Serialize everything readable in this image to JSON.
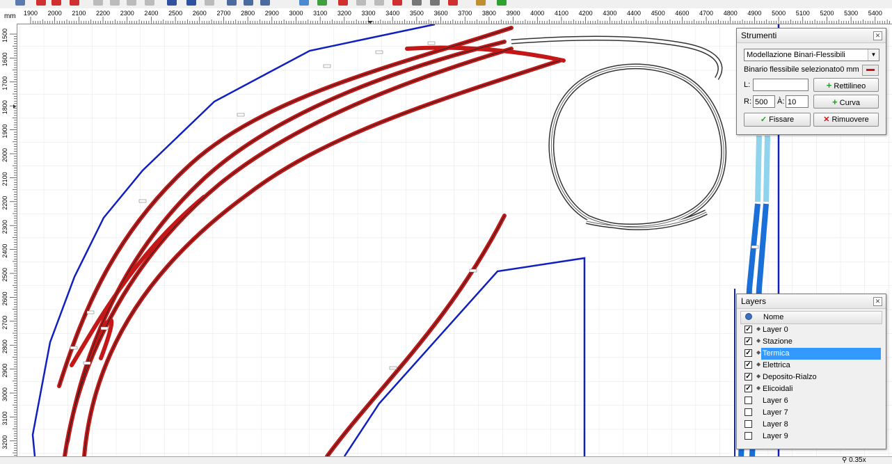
{
  "ruler": {
    "unit_label": "mm",
    "top_ticks": [
      "1900",
      "2000",
      "2100",
      "2200",
      "2300",
      "2400",
      "2500",
      "2600",
      "2700",
      "2800",
      "2900",
      "3000",
      "3100",
      "3200",
      "3300",
      "3400",
      "3500",
      "3600",
      "3700",
      "3800",
      "3900",
      "4000",
      "4100",
      "4200",
      "4300",
      "4400",
      "4500",
      "4600",
      "4700",
      "4800",
      "4900",
      "5000",
      "5100",
      "5200",
      "5300",
      "5400"
    ],
    "left_ticks": [
      "1500",
      "1600",
      "1700",
      "1800",
      "1900",
      "2000",
      "2100",
      "2200",
      "2300",
      "2400",
      "2500",
      "2600",
      "2700",
      "2800",
      "2900",
      "3000",
      "3100",
      "3200"
    ]
  },
  "strumenti": {
    "title": "Strumenti",
    "mode_value": "Modellazione Binari-Flessibili",
    "selected_info": "Binario flessibile selezionato0 mm",
    "length_label": "L:",
    "length_value": "",
    "radius_label": "R:",
    "radius_value": "500",
    "angle_label": "À:",
    "angle_value": "10",
    "straight_button": "Rettilineo",
    "curve_button": "Curva",
    "fix_button": "Fissare",
    "remove_button": "Rimuovere"
  },
  "layers": {
    "title": "Layers",
    "column_name": "Nome",
    "items": [
      {
        "name": "Layer 0",
        "checked": true,
        "bullet": true
      },
      {
        "name": "Stazione",
        "checked": true,
        "bullet": true
      },
      {
        "name": "Termica",
        "checked": true,
        "bullet": true,
        "selected": true
      },
      {
        "name": "Elettrica",
        "checked": true,
        "bullet": true
      },
      {
        "name": "Deposito-Rialzo",
        "checked": true,
        "bullet": true
      },
      {
        "name": "Elicoidali",
        "checked": true,
        "bullet": true
      },
      {
        "name": "Layer 6",
        "checked": false,
        "bullet": false
      },
      {
        "name": "Layer 7",
        "checked": false,
        "bullet": false
      },
      {
        "name": "Layer 8",
        "checked": false,
        "bullet": false
      },
      {
        "name": "Layer 9",
        "checked": false,
        "bullet": false
      }
    ]
  },
  "status": {
    "zoom": "0.35x"
  },
  "colors": {
    "track_red": "#c41818",
    "outline_blue": "#1020c0",
    "light_blue": "#8fd4ec",
    "mid_blue": "#1a6fd8",
    "selection": "#3399ff",
    "grid": "#e4e4e4"
  }
}
